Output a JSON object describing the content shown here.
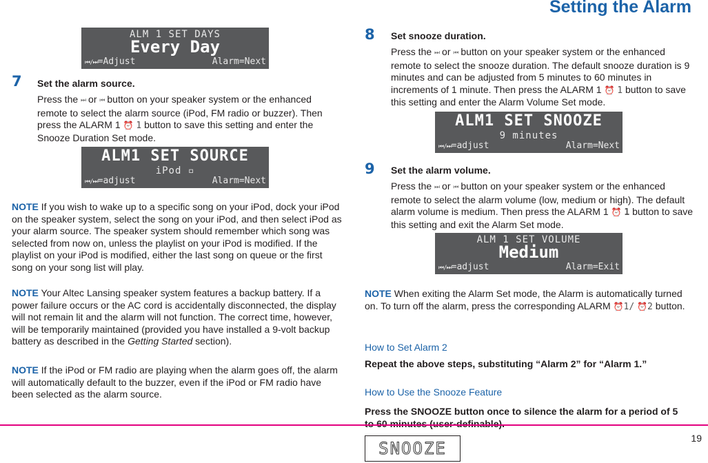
{
  "header": {
    "title": "Setting the Alarm"
  },
  "left": {
    "lcd_days": {
      "line1": "ALM 1 SET DAYS",
      "line2": "Every Day",
      "adjust_icon": "⏮/⏭",
      "adjust": "=Adjust",
      "action": "Alarm=Next"
    },
    "step7": {
      "number": "7",
      "title": "Set the alarm source.",
      "text_a": "Press the",
      "icon_next": "⏭",
      "text_or": "or",
      "icon_prev": "⏮",
      "text_b": "button on your speaker system or the enhanced remote to select the alarm source (iPod, FM radio or buzzer). Then press the ALARM 1",
      "alarm_icon": "⏰",
      "alarm_num": "1",
      "text_c": "button to save this setting and enter the Snooze Duration Set mode."
    },
    "lcd_source": {
      "line1": "ALM1 SET SOURCE",
      "line2": "iPod ▫",
      "adjust_icon": "⏮/⏭",
      "adjust": "=adjust",
      "action": "Alarm=Next"
    },
    "note1": {
      "label": "NOTE",
      "text": "If you wish to wake up to a specific song on your iPod, dock your iPod on the speaker system, select the song on your iPod, and then select iPod as your alarm source. The speaker system should remember which song was selected from now on, unless the playlist on your iPod is modified. If the playlist on your iPod is modified, either the last song on queue or the first song on your song list will play."
    },
    "note2": {
      "label": "NOTE",
      "text_a": "Your Altec Lansing speaker system features a backup battery. If a power failure occurs or the AC cord is accidentally disconnected, the display will not remain lit and the alarm will not function. The correct time, however, will be temporarily maintained (provided you have installed a 9-volt backup battery as described in the",
      "text_em": "Getting Started",
      "text_b": "section)."
    },
    "note3": {
      "label": "NOTE",
      "text": "If the iPod or FM radio are playing when the alarm goes off, the alarm will automatically default to the buzzer, even if the iPod or FM radio have been selected as the alarm source."
    }
  },
  "right": {
    "step8": {
      "number": "8",
      "title": "Set snooze duration.",
      "text_a": "Press the",
      "icon_next": "⏭",
      "text_or": "or",
      "icon_prev": "⏮",
      "text_b": "button on your speaker system or the enhanced remote to select the snooze duration. The default snooze duration is 9 minutes and can be adjusted from 5 minutes to 60 minutes in increments of 1 minute. Then press the ALARM 1",
      "alarm_icon": "⏰",
      "alarm_num": "1",
      "text_c": "button to save this setting and enter the Alarm Volume Set mode."
    },
    "lcd_snooze": {
      "line1": "ALM1 SET SNOOZE",
      "line2": "9 minutes",
      "adjust_icon": "⏮/⏭",
      "adjust": "=adjust",
      "action": "Alarm=Next"
    },
    "step9": {
      "number": "9",
      "title": "Set the alarm volume.",
      "text_a": "Press the",
      "icon_next": "⏭",
      "text_or": "or",
      "icon_prev": "⏮",
      "text_b": "button on your speaker system or the enhanced remote to select the alarm volume (low, medium or high). The default alarm volume is medium. Then press the ALARM 1",
      "alarm_icon": "⏰",
      "alarm_num": "1",
      "text_c": "button to save this setting and exit the Alarm Set mode."
    },
    "lcd_volume": {
      "line1": "ALM 1 SET VOLUME",
      "line2": "Medium",
      "adjust_icon": "⏮/⏭",
      "adjust": "=adjust",
      "action": "Alarm=Exit"
    },
    "note4": {
      "label": "NOTE",
      "text_a": "When exiting the Alarm Set mode, the Alarm is automatically turned on. To turn off the alarm, press the corresponding ALARM",
      "alarm_icon": "⏰",
      "alarm_num1": "1",
      "slash": "/",
      "alarm_num2": "2",
      "text_b": "button."
    },
    "alarm2": {
      "heading": "How to Set Alarm 2",
      "text": "Repeat the above steps, substituting “Alarm 2” for “Alarm 1.”"
    },
    "snooze": {
      "heading": "How to Use the Snooze Feature",
      "text": "Press the SNOOZE button once to silence the alarm for a period of 5 to 60 minutes (user-definable).",
      "display": "SNOOZE"
    }
  },
  "footer": {
    "page_number": "19",
    "rule_color": "#e3007e"
  },
  "colors": {
    "accent": "#1c63a8",
    "lcd_bg": "#58595b",
    "text": "#231f20"
  }
}
